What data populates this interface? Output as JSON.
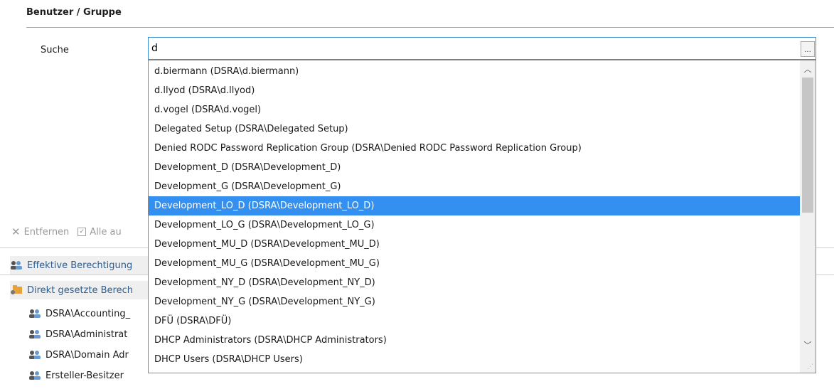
{
  "section": {
    "title": "Benutzer / Gruppe"
  },
  "search": {
    "label": "Suche",
    "value": "d",
    "browse_label": "..."
  },
  "toolbar": {
    "remove_label": "Entfernen",
    "select_all_label": "Alle au"
  },
  "tree": {
    "effective_label": "Effektive Berechtigung",
    "direct_label": "Direkt gesetzte Berech",
    "entries": [
      "DSRA\\Accounting_",
      "DSRA\\Administrat",
      "DSRA\\Domain Adr",
      "Ersteller-Besitzer"
    ]
  },
  "dropdown": {
    "items": [
      "d.biermann (DSRA\\d.biermann)",
      "d.llyod (DSRA\\d.llyod)",
      "d.vogel (DSRA\\d.vogel)",
      "Delegated Setup (DSRA\\Delegated Setup)",
      "Denied RODC Password Replication Group (DSRA\\Denied RODC Password Replication Group)",
      "Development_D (DSRA\\Development_D)",
      "Development_G (DSRA\\Development_G)",
      "Development_LO_D (DSRA\\Development_LO_D)",
      "Development_LO_G (DSRA\\Development_LO_G)",
      "Development_MU_D (DSRA\\Development_MU_D)",
      "Development_MU_G (DSRA\\Development_MU_G)",
      "Development_NY_D (DSRA\\Development_NY_D)",
      "Development_NY_G (DSRA\\Development_NY_G)",
      "DFÜ (DSRA\\DFÜ)",
      "DHCP Administrators (DSRA\\DHCP Administrators)",
      "DHCP Users (DSRA\\DHCP Users)"
    ],
    "selected_index": 7,
    "selection_color": "#3390f0"
  }
}
